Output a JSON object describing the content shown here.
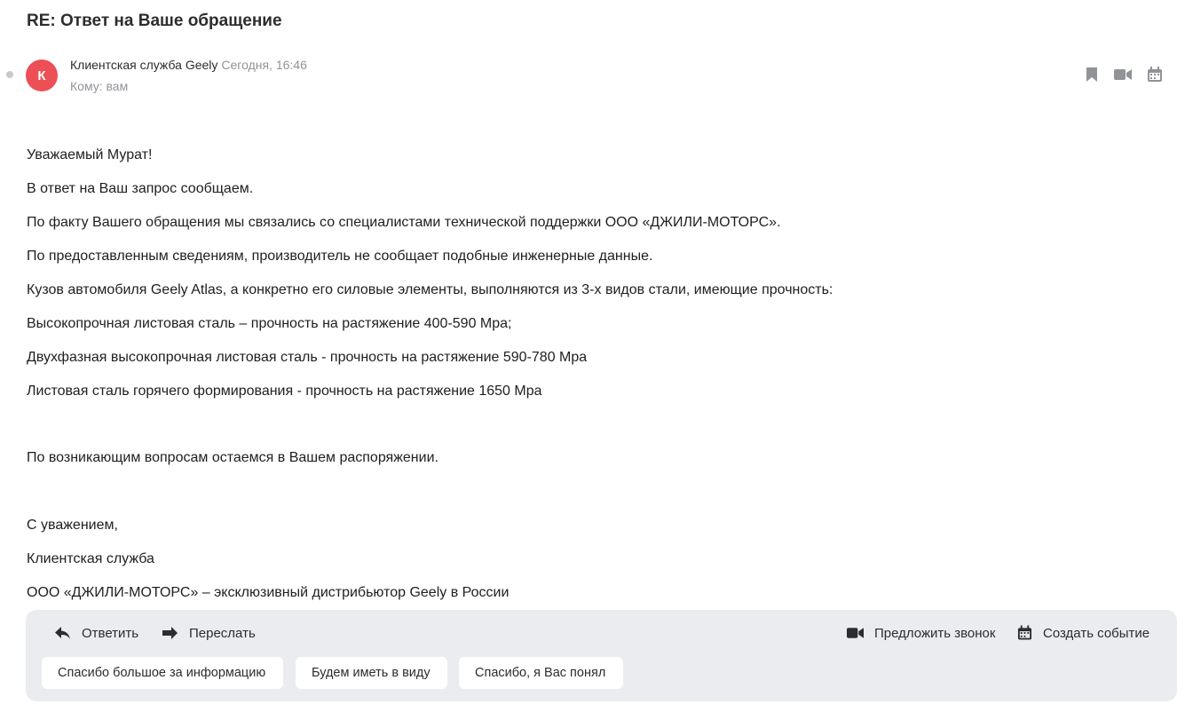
{
  "email": {
    "subject": "RE: Ответ на Ваше обращение",
    "sender_name": "Клиентская служба Geely",
    "avatar_letter": "К",
    "date": "Сегодня, 16:46",
    "to": "Кому: вам"
  },
  "body": {
    "lines": [
      "Уважаемый Мурат!",
      "В ответ на Ваш запрос сообщаем.",
      "По факту Вашего обращения мы связались со специалистами технической поддержки ООО «ДЖИЛИ-МОТОРС».",
      "По предоставленным сведениям, производитель не сообщает подобные инженерные данные.",
      "Кузов автомобиля Geely Atlas, а конкретно его силовые элементы, выполняются из 3-х видов стали, имеющие прочность:",
      "Высокопрочная листовая сталь – прочность на растяжение 400-590 Mpa;",
      "Двухфазная высокопрочная листовая сталь - прочность на растяжение 590-780 Mpa",
      "Листовая сталь горячего формирования - прочность на растяжение 1650 Mpa",
      "По возникающим вопросам остаемся в Вашем распоряжении.",
      "С уважением,",
      "Клиентская служба",
      "ООО «ДЖИЛИ-МОТОРС» – эксклюзивный дистрибьютор Geely в России"
    ]
  },
  "actions": {
    "reply": "Ответить",
    "forward": "Переслать",
    "suggest_call": "Предложить звонок",
    "create_event": "Создать событие"
  },
  "quick_replies": [
    "Спасибо большое за информацию",
    "Будем иметь в виду",
    "Спасибо, я Вас понял"
  ],
  "icons": {
    "top_actions": [
      "bookmark-icon",
      "video-camera-icon",
      "calendar-icon",
      "more-icon"
    ],
    "reply": "reply-arrow-icon",
    "forward": "forward-arrow-icon",
    "call": "video-camera-icon",
    "event": "calendar-icon"
  },
  "colors": {
    "avatar": "#ec4f55",
    "panel": "#ebecef",
    "muted_text": "#919399",
    "icon": "#919399"
  }
}
